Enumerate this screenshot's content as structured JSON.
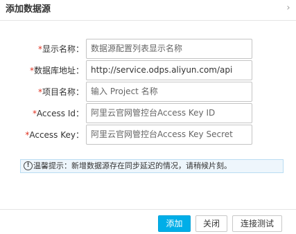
{
  "dialog": {
    "title": "添加数据源",
    "close_glyph": "›"
  },
  "form": {
    "fields": [
      {
        "required_mark": "*",
        "label": "显示名称：",
        "value": "",
        "placeholder": "数据源配置列表显示名称"
      },
      {
        "required_mark": "*",
        "label": "数据库地址：",
        "value": "http://service.odps.aliyun.com/api",
        "placeholder": ""
      },
      {
        "required_mark": "*",
        "label": "项目名称：",
        "value": "",
        "placeholder": "输入 Project 名称"
      },
      {
        "required_mark": "*",
        "label": "Access Id：",
        "value": "",
        "placeholder": "阿里云官网管控台Access Key ID"
      },
      {
        "required_mark": "*",
        "label": "Access Key：",
        "value": "",
        "placeholder": "阿里云官网管控台Access Key Secret"
      }
    ]
  },
  "notice": {
    "icon": "exclamation-icon",
    "icon_glyph": "!",
    "text": "温馨提示：新增数据源存在同步延迟的情况，请稍候片刻。"
  },
  "footer": {
    "add_label": "添加",
    "close_label": "关闭",
    "test_label": "连接测试"
  },
  "colors": {
    "primary": "#00aee8",
    "required": "#e0301e",
    "notice_bg": "#eef6fc"
  }
}
